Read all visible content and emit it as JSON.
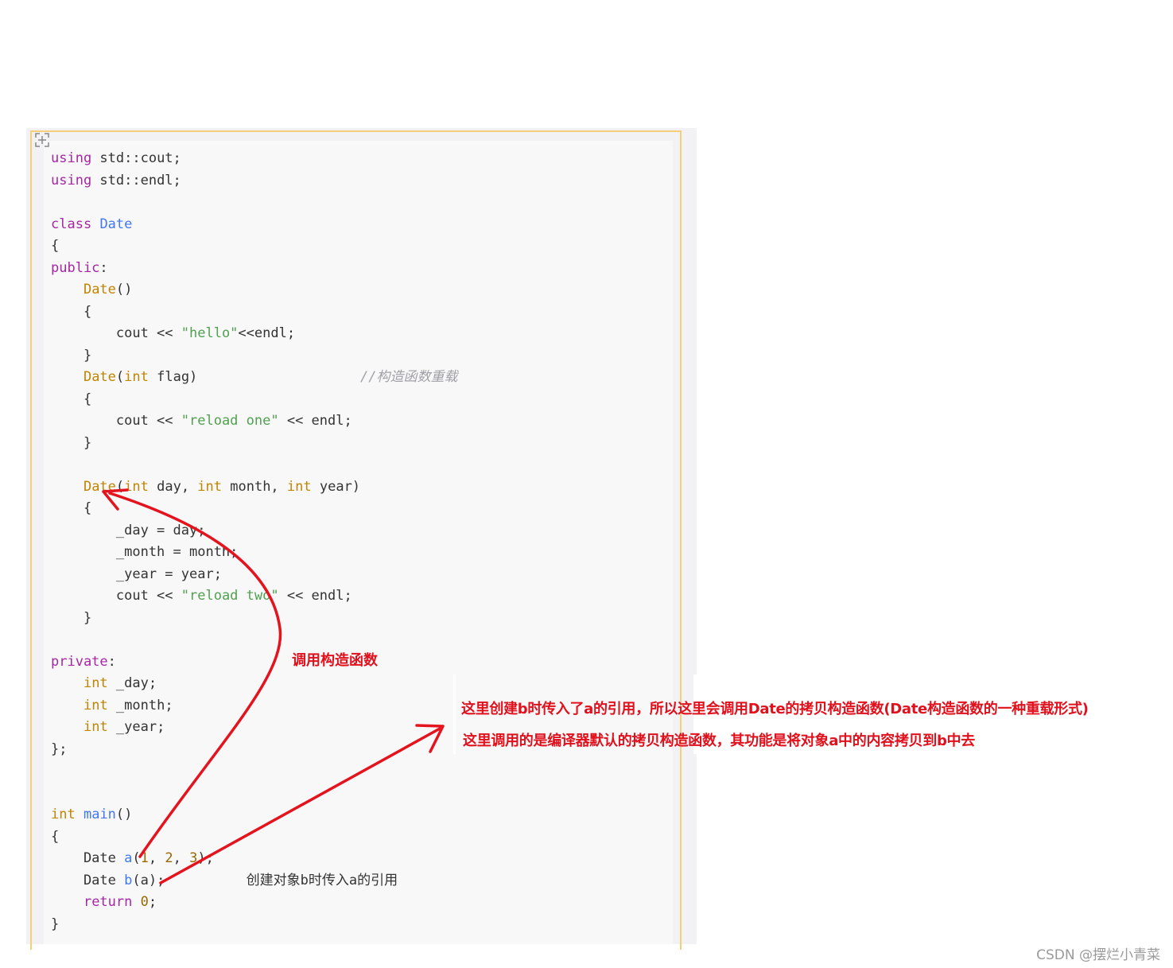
{
  "code": {
    "lines": [
      [
        {
          "t": "using",
          "c": "kw"
        },
        {
          "t": " std::cout;"
        }
      ],
      [
        {
          "t": "using",
          "c": "kw"
        },
        {
          "t": " std::endl;"
        }
      ],
      [],
      [
        {
          "t": "class",
          "c": "kw"
        },
        {
          "t": " "
        },
        {
          "t": "Date",
          "c": "fn"
        }
      ],
      [
        {
          "t": "{"
        }
      ],
      [
        {
          "t": "public",
          "c": "kw"
        },
        {
          "t": ":"
        }
      ],
      [
        {
          "t": "    "
        },
        {
          "t": "Date",
          "c": "ty"
        },
        {
          "t": "()"
        }
      ],
      [
        {
          "t": "    {"
        }
      ],
      [
        {
          "t": "        cout << "
        },
        {
          "t": "\"hello\"",
          "c": "st"
        },
        {
          "t": "<<endl;"
        }
      ],
      [
        {
          "t": "    }"
        }
      ],
      [
        {
          "t": "    "
        },
        {
          "t": "Date",
          "c": "ty"
        },
        {
          "t": "("
        },
        {
          "t": "int",
          "c": "ty"
        },
        {
          "t": " flag)                    "
        },
        {
          "t": "//构造函数重载",
          "c": "cm"
        }
      ],
      [
        {
          "t": "    {"
        }
      ],
      [
        {
          "t": "        cout << "
        },
        {
          "t": "\"reload one\"",
          "c": "st"
        },
        {
          "t": " << endl;"
        }
      ],
      [
        {
          "t": "    }"
        }
      ],
      [],
      [
        {
          "t": "    "
        },
        {
          "t": "Date",
          "c": "ty"
        },
        {
          "t": "("
        },
        {
          "t": "int",
          "c": "ty"
        },
        {
          "t": " day, "
        },
        {
          "t": "int",
          "c": "ty"
        },
        {
          "t": " month, "
        },
        {
          "t": "int",
          "c": "ty"
        },
        {
          "t": " year)"
        }
      ],
      [
        {
          "t": "    {"
        }
      ],
      [
        {
          "t": "        _day = day;"
        }
      ],
      [
        {
          "t": "        _month = month;"
        }
      ],
      [
        {
          "t": "        _year = year;"
        }
      ],
      [
        {
          "t": "        cout << "
        },
        {
          "t": "\"reload two\"",
          "c": "st"
        },
        {
          "t": " << endl;"
        }
      ],
      [
        {
          "t": "    }"
        }
      ],
      [],
      [
        {
          "t": "private",
          "c": "kw"
        },
        {
          "t": ":"
        }
      ],
      [
        {
          "t": "    "
        },
        {
          "t": "int",
          "c": "ty"
        },
        {
          "t": " _day;"
        }
      ],
      [
        {
          "t": "    "
        },
        {
          "t": "int",
          "c": "ty"
        },
        {
          "t": " _month;"
        }
      ],
      [
        {
          "t": "    "
        },
        {
          "t": "int",
          "c": "ty"
        },
        {
          "t": " _year;"
        }
      ],
      [
        {
          "t": "};"
        }
      ],
      [],
      [],
      [
        {
          "t": "int",
          "c": "ty"
        },
        {
          "t": " "
        },
        {
          "t": "main",
          "c": "fn"
        },
        {
          "t": "()"
        }
      ],
      [
        {
          "t": "{"
        }
      ],
      [
        {
          "t": "    Date "
        },
        {
          "t": "a",
          "c": "fn"
        },
        {
          "t": "("
        },
        {
          "t": "1",
          "c": "nu"
        },
        {
          "t": ", "
        },
        {
          "t": "2",
          "c": "nu"
        },
        {
          "t": ", "
        },
        {
          "t": "3",
          "c": "nu"
        },
        {
          "t": ");"
        }
      ],
      [
        {
          "t": "    Date "
        },
        {
          "t": "b",
          "c": "fn"
        },
        {
          "t": "(a);          创建对象b时传入a的引用"
        }
      ],
      [
        {
          "t": "    "
        },
        {
          "t": "return",
          "c": "kw"
        },
        {
          "t": " "
        },
        {
          "t": "0",
          "c": "nu"
        },
        {
          "t": ";"
        }
      ],
      [
        {
          "t": "}"
        }
      ]
    ]
  },
  "annotations": {
    "call_constructor": "调用构造函数",
    "line1": "这里创建b时传入了a的引用，所以这里会调用Date的拷贝构造函数(Date构造函数的一种重载形式)",
    "line2": "这里调用的是编译器默认的拷贝构造函数，其功能是将对象a中的内容拷贝到b中去"
  },
  "watermark": "CSDN @摆烂小青菜",
  "colors": {
    "annotation_red": "#e0101c",
    "keyword": "#a626a4",
    "type": "#c18401",
    "function": "#4078f2",
    "string": "#50a14f",
    "comment": "#a0a1a7",
    "number": "#986801",
    "frame_border": "#f5cf7a"
  },
  "icons": {
    "expand": "expand-icon"
  }
}
